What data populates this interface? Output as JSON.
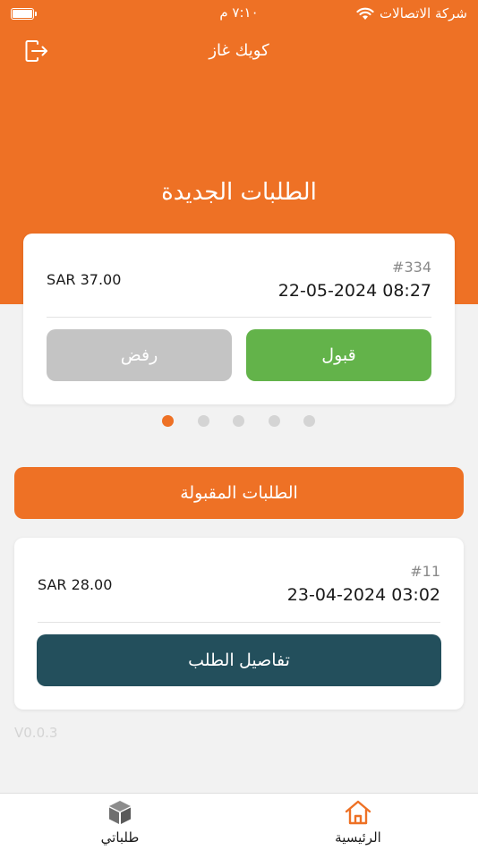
{
  "status_bar": {
    "carrier": "شركة الاتصالات",
    "time": "٧:١٠ م"
  },
  "header": {
    "title": "كويك غاز"
  },
  "new_orders": {
    "title": "الطلبات الجديدة",
    "order": {
      "id": "#334",
      "date": "22-05-2024 08:27",
      "price": "SAR 37.00",
      "accept_label": "قبول",
      "reject_label": "رفض"
    },
    "pagination": {
      "count": 5,
      "active_index": 0
    }
  },
  "accepted_orders": {
    "title": "الطلبات المقبولة",
    "order": {
      "id": "#11",
      "date": "23-04-2024 03:02",
      "price": "SAR 28.00",
      "details_label": "تفاصيل الطلب"
    }
  },
  "version": "V0.0.3",
  "tabbar": {
    "home_label": "الرئيسية",
    "orders_label": "طلباتي"
  },
  "colors": {
    "brand_orange": "#ee7125",
    "accept_green": "#63b34a",
    "reject_gray": "#c4c4c4",
    "details_teal": "#234f5c"
  }
}
